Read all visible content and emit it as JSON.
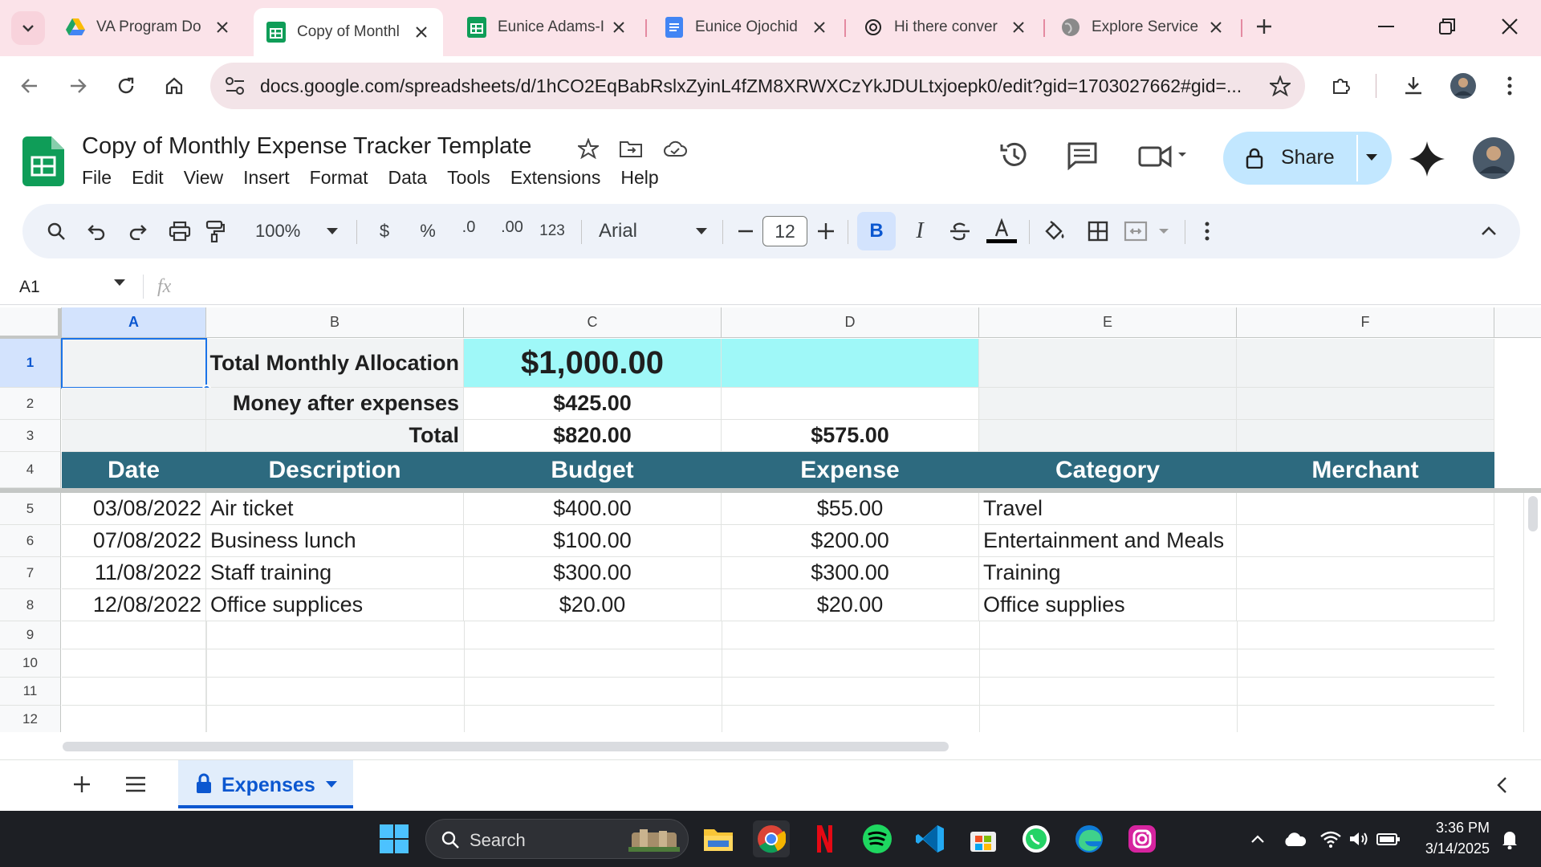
{
  "browser": {
    "tabs": [
      {
        "title": "VA Program Do",
        "icon": "google-drive-icon",
        "active": false
      },
      {
        "title": "Copy of Monthl",
        "icon": "google-sheets-icon",
        "active": true
      },
      {
        "title": "Eunice Adams-I",
        "icon": "google-sheets-icon",
        "active": false
      },
      {
        "title": "Eunice Ojochid",
        "icon": "google-docs-icon",
        "active": false
      },
      {
        "title": "Hi there conver",
        "icon": "chatgpt-icon",
        "active": false
      },
      {
        "title": "Explore Service",
        "icon": "globe-icon",
        "active": false
      }
    ],
    "url": "docs.google.com/spreadsheets/d/1hCO2EqBabRslxZyinL4fZM8XRWXCzYkJDULtxjoepk0/edit?gid=1703027662#gid=..."
  },
  "sheet_app": {
    "title": "Copy of Monthly Expense Tracker Template",
    "menus": [
      "File",
      "Edit",
      "View",
      "Insert",
      "Format",
      "Data",
      "Tools",
      "Extensions",
      "Help"
    ],
    "share_label": "Share"
  },
  "toolbar": {
    "zoom": "100%",
    "currency": "$",
    "percent": "%",
    "dec_decrease": ".0",
    "dec_increase": ".00",
    "number_format": "123",
    "font": "Arial",
    "font_size": "12",
    "bold": "B",
    "italic": "I"
  },
  "formula_bar": {
    "cell_ref": "A1",
    "fx": "fx",
    "value": ""
  },
  "grid": {
    "columns": [
      "A",
      "B",
      "C",
      "D",
      "E",
      "F"
    ],
    "row_numbers": [
      "1",
      "2",
      "3",
      "4",
      "5",
      "6",
      "7",
      "8",
      "9",
      "10",
      "11",
      "12"
    ],
    "summary": {
      "total_allocation_label": "Total Monthly Allocation",
      "total_allocation_value": "$1,000.00",
      "money_after_label": "Money after expenses",
      "money_after_value": "$425.00",
      "total_label": "Total",
      "total_budget": "$820.00",
      "total_expense": "$575.00"
    },
    "headers": [
      "Date",
      "Description",
      "Budget",
      "Expense",
      "Category",
      "Merchant"
    ],
    "rows": [
      {
        "date": "03/08/2022",
        "description": "Air ticket",
        "budget": "$400.00",
        "expense": "$55.00",
        "category": "Travel",
        "merchant": ""
      },
      {
        "date": "07/08/2022",
        "description": "Business lunch",
        "budget": "$100.00",
        "expense": "$200.00",
        "category": "Entertainment and Meals",
        "merchant": ""
      },
      {
        "date": "11/08/2022",
        "description": "Staff training",
        "budget": "$300.00",
        "expense": "$300.00",
        "category": "Training",
        "merchant": ""
      },
      {
        "date": "12/08/2022",
        "description": "Office supplices",
        "budget": "$20.00",
        "expense": "$20.00",
        "category": "Office supplies",
        "merchant": ""
      }
    ],
    "colors": {
      "header_bg": "#2d6a7f",
      "highlight": "#9ff8f8"
    }
  },
  "sheet_tabs": [
    {
      "name": "Expenses",
      "locked": true
    }
  ],
  "taskbar": {
    "search_placeholder": "Search",
    "time": "3:36 PM",
    "date": "3/14/2025"
  }
}
